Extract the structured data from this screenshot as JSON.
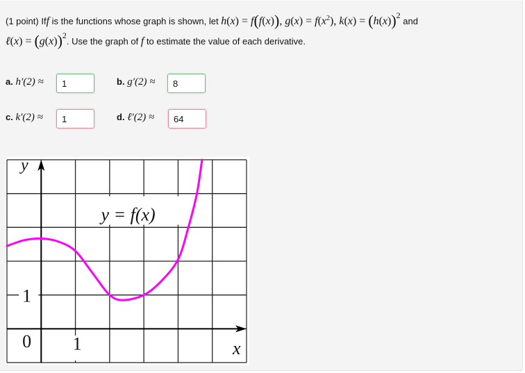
{
  "problem": {
    "points": "(1 point)",
    "intro_if": "If",
    "intro_f": "f",
    "intro_rest": "is the functions whose graph is shown, let",
    "h_def": "h(x) = f(f(x))",
    "g_def": "g(x) = f(x²)",
    "k_def": "k(x) = (h(x))²",
    "and": "and",
    "l_def": "ℓ(x) = (g(x))²",
    "instruction_pre": ". Use the graph of",
    "instruction_f": "f",
    "instruction_post": "to estimate the value of each derivative."
  },
  "questions": [
    {
      "label": "a.",
      "expr": "h′(2) ≈",
      "answer": "1",
      "status": "correct"
    },
    {
      "label": "b.",
      "expr": "g′(2) ≈",
      "answer": "8",
      "status": "correct"
    },
    {
      "label": "c.",
      "expr": "k′(2) ≈",
      "answer": "1",
      "status": "incorrect"
    },
    {
      "label": "d.",
      "expr": "ℓ′(2) ≈",
      "answer": "64",
      "status": "incorrect"
    }
  ],
  "status_colors": {
    "correct": "#6cc07a",
    "incorrect": "#e08a93"
  },
  "chart_data": {
    "type": "line",
    "title": "y = f(x)",
    "xlabel": "x",
    "ylabel": "y",
    "xlim": [
      -1,
      6
    ],
    "ylim": [
      -1,
      5
    ],
    "grid": true,
    "curve_color": "#ff00ff",
    "tick_labels": {
      "x": [
        "1"
      ],
      "y": [
        "1"
      ],
      "origin": "0"
    },
    "series": [
      {
        "name": "f(x)",
        "x": [
          -1.0,
          -0.5,
          0.0,
          0.5,
          1.0,
          1.5,
          2.0,
          2.4,
          3.0,
          3.5,
          4.0,
          4.3,
          4.55,
          4.7
        ],
        "y": [
          2.45,
          2.62,
          2.67,
          2.58,
          2.3,
          1.65,
          1.0,
          0.85,
          1.0,
          1.4,
          2.05,
          3.0,
          4.0,
          5.0
        ]
      }
    ]
  }
}
